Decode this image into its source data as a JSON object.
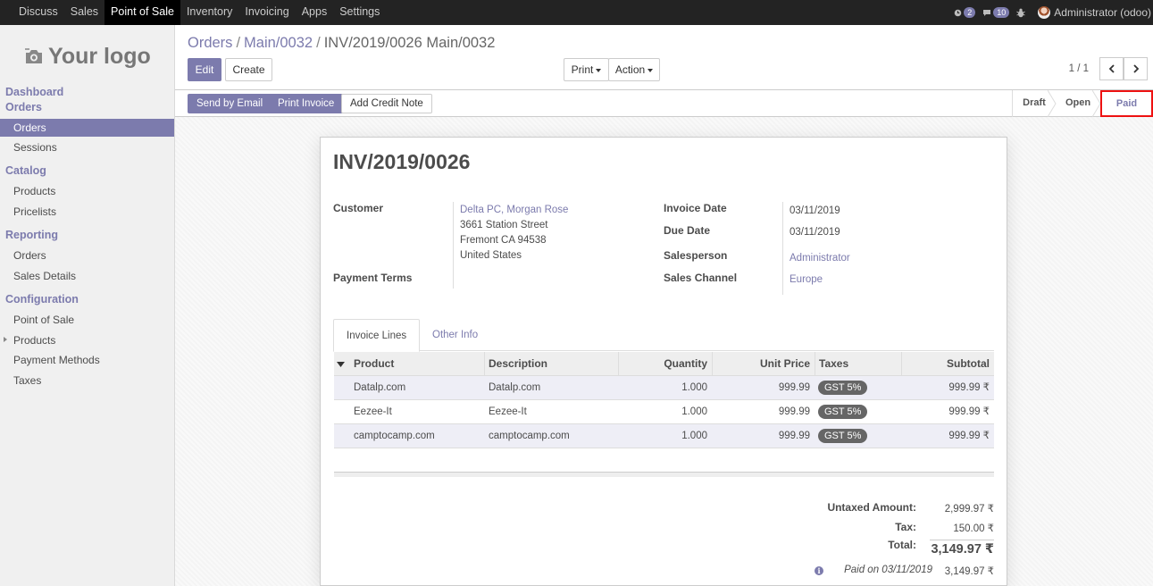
{
  "topnav": {
    "items": [
      "Discuss",
      "Sales",
      "Point of Sale",
      "Inventory",
      "Invoicing",
      "Apps",
      "Settings"
    ],
    "active": "Point of Sale",
    "activity_count": "2",
    "message_count": "10",
    "user": "Administrator (odoo)"
  },
  "sidebar": {
    "logo_text": "Your logo",
    "dashboard": "Dashboard",
    "orders_heading": "Orders",
    "orders_items": [
      "Orders",
      "Sessions"
    ],
    "catalog_heading": "Catalog",
    "catalog_items": [
      "Products",
      "Pricelists"
    ],
    "reporting_heading": "Reporting",
    "reporting_items": [
      "Orders",
      "Sales Details"
    ],
    "config_heading": "Configuration",
    "config_items": [
      "Point of Sale",
      "Products",
      "Payment Methods",
      "Taxes"
    ]
  },
  "breadcrumb": {
    "part1": "Orders",
    "part2": "Main/0032",
    "current": "INV/2019/0026 Main/0032",
    "sep": "/"
  },
  "toolbar": {
    "edit": "Edit",
    "create": "Create",
    "print": "Print",
    "action": "Action",
    "pager": "1 / 1"
  },
  "statusbar": {
    "send_email": "Send by Email",
    "print_invoice": "Print Invoice",
    "add_credit_note": "Add Credit Note",
    "stages": [
      "Draft",
      "Open",
      "Paid"
    ],
    "current_stage": "Paid"
  },
  "invoice": {
    "number": "INV/2019/0026",
    "customer_label": "Customer",
    "customer_name": "Delta PC, Morgan Rose",
    "address1": "3661 Station Street",
    "address2": "Fremont CA 94538",
    "address3": "United States",
    "payment_terms_label": "Payment Terms",
    "invoice_date_label": "Invoice Date",
    "invoice_date": "03/11/2019",
    "due_date_label": "Due Date",
    "due_date": "03/11/2019",
    "salesperson_label": "Salesperson",
    "salesperson": "Administrator",
    "sales_channel_label": "Sales Channel",
    "sales_channel": "Europe"
  },
  "tabs": [
    "Invoice Lines",
    "Other Info"
  ],
  "lines": {
    "headers": [
      "Product",
      "Description",
      "Quantity",
      "Unit Price",
      "Taxes",
      "Subtotal"
    ],
    "rows": [
      {
        "product": "Datalp.com",
        "description": "Datalp.com",
        "quantity": "1.000",
        "unit_price": "999.99",
        "tax": "GST 5%",
        "subtotal": "999.99 ₹"
      },
      {
        "product": "Eezee-It",
        "description": "Eezee-It",
        "quantity": "1.000",
        "unit_price": "999.99",
        "tax": "GST 5%",
        "subtotal": "999.99 ₹"
      },
      {
        "product": "camptocamp.com",
        "description": "camptocamp.com",
        "quantity": "1.000",
        "unit_price": "999.99",
        "tax": "GST 5%",
        "subtotal": "999.99 ₹"
      }
    ]
  },
  "totals": {
    "untaxed_label": "Untaxed Amount:",
    "untaxed": "2,999.97 ₹",
    "tax_label": "Tax:",
    "tax": "150.00 ₹",
    "total_label": "Total:",
    "total": "3,149.97 ₹",
    "paid_on": "Paid on 03/11/2019",
    "paid_amount": "3,149.97 ₹"
  },
  "colors": {
    "brand": "#7c7bad",
    "topbar": "#232323",
    "highlight": "#e11111"
  }
}
